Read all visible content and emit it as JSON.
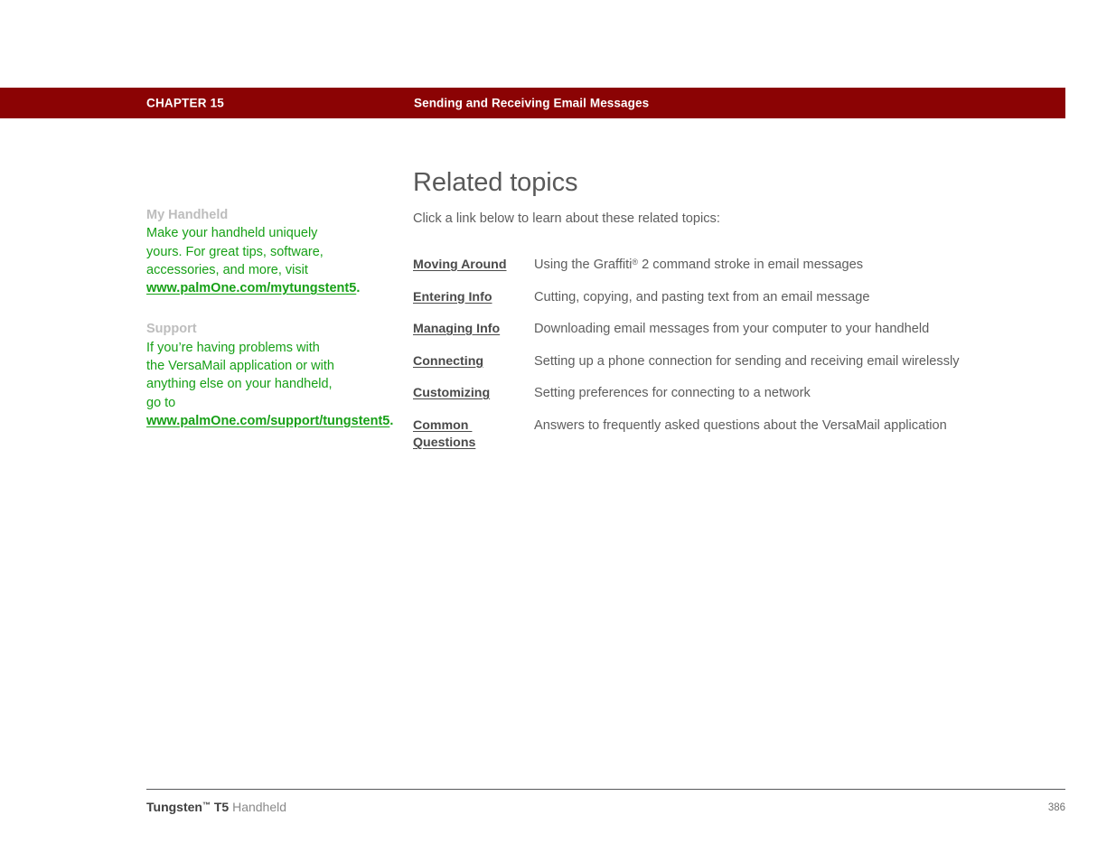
{
  "header": {
    "chapter_label": "CHAPTER 15",
    "chapter_title": "Sending and Receiving Email Messages",
    "bar_color": "#8b0304",
    "text_color": "#ffffff"
  },
  "sidebar": {
    "accent_color": "#17a017",
    "heading_color": "#bdbdbd",
    "blocks": [
      {
        "heading": "My Handheld",
        "body": "Make your handheld uniquely yours. For great tips, software, accessories, and more, visit ",
        "link": "www.palmOne.com/mytungstent5",
        "trailing": "."
      },
      {
        "heading": "Support",
        "body": "If you’re having problems with the VersaMail application or with anything else on your handheld, go to ",
        "link": "www.palmOne.com/support/tungstent5",
        "trailing": "."
      }
    ]
  },
  "main": {
    "title": "Related topics",
    "intro": "Click a link below to learn about these related topics:",
    "topics": [
      {
        "link": "Moving Around",
        "description_pre": "Using the Graffiti",
        "description_sup": "®",
        "description_post": " 2 command stroke in email messages"
      },
      {
        "link": "Entering Info",
        "description_pre": "Cutting, copying, and pasting text from an email message",
        "description_sup": "",
        "description_post": ""
      },
      {
        "link": "Managing Info",
        "description_pre": "Downloading email messages from your computer to your handheld",
        "description_sup": "",
        "description_post": ""
      },
      {
        "link": "Connecting",
        "description_pre": "Setting up a phone connection for sending and receiving email wirelessly",
        "description_sup": "",
        "description_post": ""
      },
      {
        "link": "Customizing",
        "description_pre": "Setting preferences for connecting to a network",
        "description_sup": "",
        "description_post": ""
      },
      {
        "link": "Common Questions",
        "description_pre": "Answers to frequently asked questions about the VersaMail application",
        "description_sup": "",
        "description_post": ""
      }
    ]
  },
  "footer": {
    "product_bold": "Tungsten",
    "product_tm": "™",
    "product_model": " T5",
    "product_light": " Handheld",
    "page_number": "386"
  }
}
